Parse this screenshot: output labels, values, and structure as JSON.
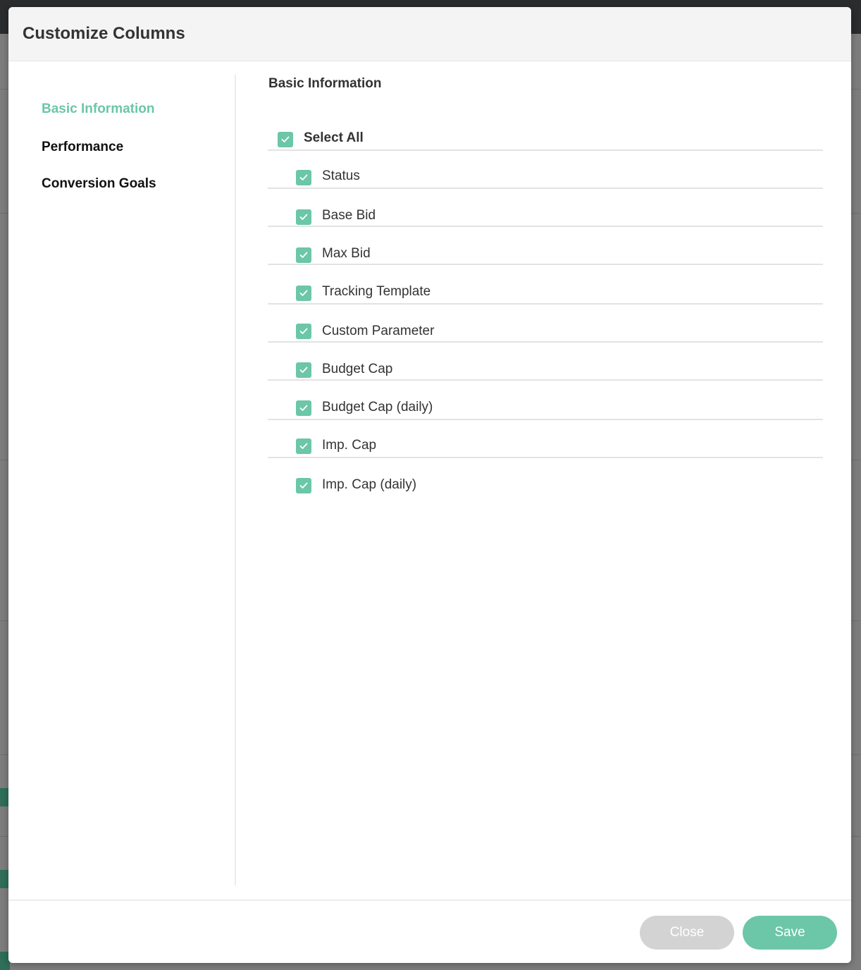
{
  "modal": {
    "title": "Customize Columns"
  },
  "sidebar": {
    "items": [
      {
        "label": "Basic Information",
        "active": true
      },
      {
        "label": "Performance",
        "active": false
      },
      {
        "label": "Conversion Goals",
        "active": false
      }
    ]
  },
  "content": {
    "section_title": "Basic Information",
    "select_all": {
      "label": "Select All",
      "checked": true
    },
    "columns": [
      {
        "label": "Status",
        "checked": true
      },
      {
        "label": "Base Bid",
        "checked": true
      },
      {
        "label": "Max Bid",
        "checked": true
      },
      {
        "label": "Tracking Template",
        "checked": true
      },
      {
        "label": "Custom Parameter",
        "checked": true
      },
      {
        "label": "Budget Cap",
        "checked": true
      },
      {
        "label": "Budget Cap (daily)",
        "checked": true
      },
      {
        "label": "Imp. Cap",
        "checked": true
      },
      {
        "label": "Imp. Cap (daily)",
        "checked": true
      }
    ]
  },
  "footer": {
    "close_label": "Close",
    "save_label": "Save"
  },
  "colors": {
    "accent": "#6cc6a8",
    "close_button": "#d3d3d3",
    "header_bg": "#f4f4f4",
    "backdrop": "#7d7d7d"
  },
  "icons": {
    "checkbox_check": "check-icon"
  }
}
